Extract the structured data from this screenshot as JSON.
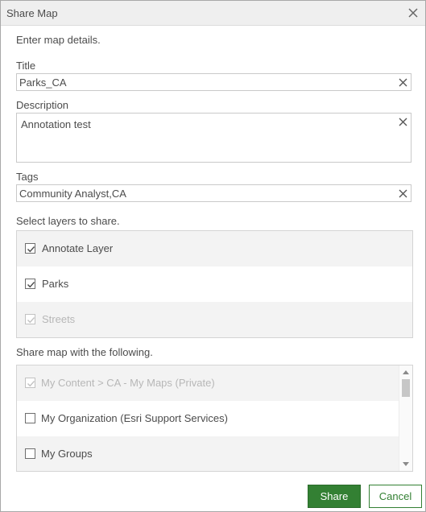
{
  "dialog": {
    "title": "Share Map",
    "intro": "Enter map details."
  },
  "form": {
    "title_label": "Title",
    "title_value": "Parks_CA",
    "description_label": "Description",
    "description_value": "Annotation test",
    "tags_label": "Tags",
    "tags_value": "Community Analyst,CA"
  },
  "layers": {
    "heading": "Select layers to share.",
    "items": [
      {
        "label": "Annotate Layer",
        "checked": true,
        "disabled": false
      },
      {
        "label": "Parks",
        "checked": true,
        "disabled": false
      },
      {
        "label": "Streets",
        "checked": true,
        "disabled": true
      }
    ]
  },
  "share_with": {
    "heading": "Share map with the following.",
    "items": [
      {
        "label": "My Content > CA - My Maps (Private)",
        "checked": true,
        "disabled": true
      },
      {
        "label": "My Organization (Esri Support Services)",
        "checked": false,
        "disabled": false
      },
      {
        "label": "My Groups",
        "checked": false,
        "disabled": false
      }
    ]
  },
  "buttons": {
    "share_label": "Share",
    "cancel_label": "Cancel"
  },
  "colors": {
    "accent_green": "#338033",
    "titlebar_bg": "#efefef",
    "row_shade": "#f3f3f3"
  },
  "icons": {
    "close": "close-icon",
    "clear": "clear-x-icon",
    "check": "checkmark-icon"
  }
}
